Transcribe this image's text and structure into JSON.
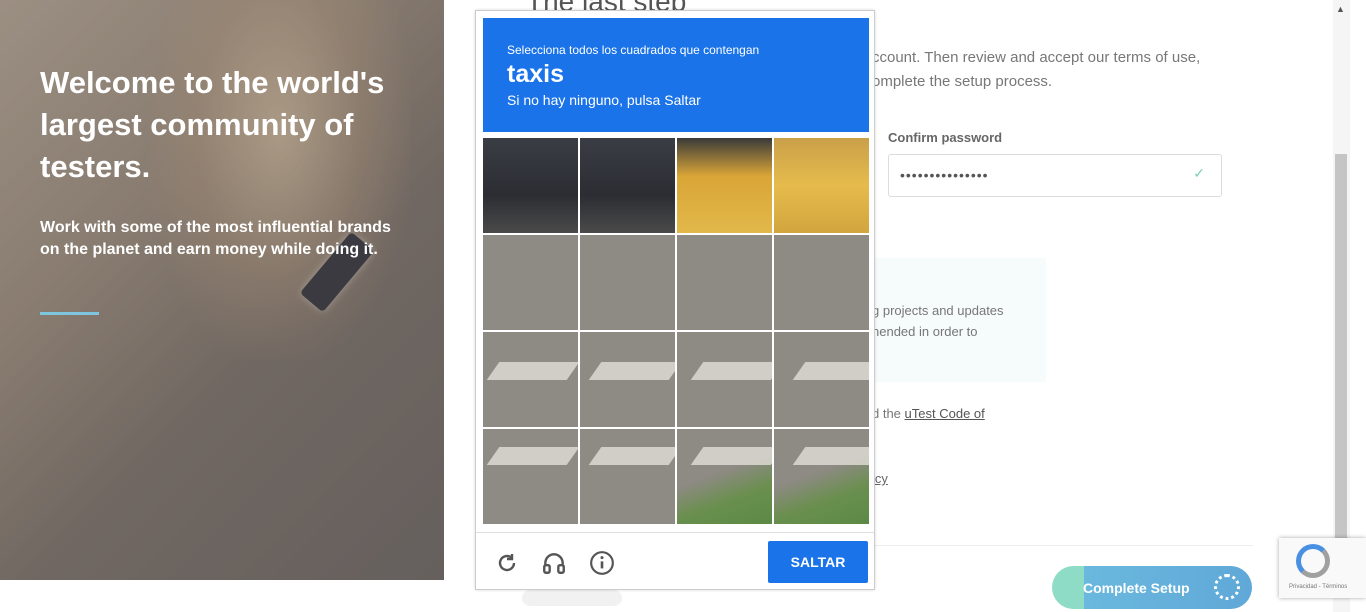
{
  "hero": {
    "title": "Welcome to the world's largest community of testers.",
    "subtitle": "Work with some of the most influential brands on the planet and earn money while doing it.",
    "accent_color": "#7ec6de"
  },
  "form": {
    "heading": "The last step",
    "description": "ccount. Then review and accept our terms of use, omplete the setup process.",
    "confirm_password_label": "Confirm password",
    "confirm_password_value": "•••••••••••••••",
    "valid_icon": "check-icon",
    "info_box_text": "g projects and updates nended in order to",
    "code_prefix": "d the ",
    "code_link": "uTest Code of",
    "policy_fragment": "icy",
    "submit_label": "Complete Setup",
    "submit_colors": [
      "#8fdcc6",
      "#6ab8de"
    ]
  },
  "recaptcha_badge": {
    "text": "Privacidad - Términos"
  },
  "captcha": {
    "instruction": "Selecciona todos los cuadrados que contengan",
    "target": "taxis",
    "hint": "Si no hay ninguno, pulsa Saltar",
    "skip_label": "SALTAR",
    "header_color": "#1a73e8",
    "controls": [
      "reload-icon",
      "headphones-icon",
      "info-icon"
    ],
    "grid": {
      "rows": 4,
      "cols": 4
    }
  }
}
